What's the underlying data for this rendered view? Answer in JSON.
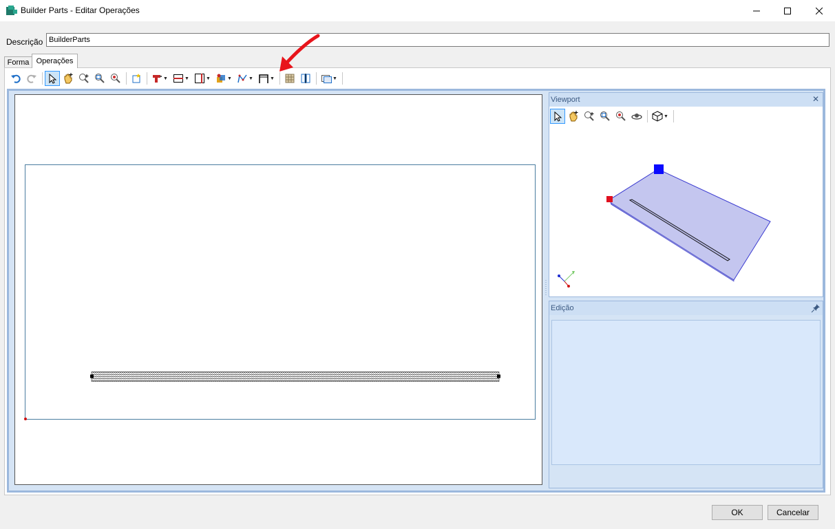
{
  "window": {
    "title": "Builder Parts - Editar Operações"
  },
  "description": {
    "label": "Descrição",
    "value": "BuilderParts"
  },
  "tabs": [
    {
      "label": "Forma"
    },
    {
      "label": "Operações"
    }
  ],
  "toolbar": {
    "icons": [
      "undo-icon",
      "redo-icon",
      "select-pointer-icon",
      "pan-hand-icon",
      "zoom-extents-icon",
      "zoom-window-icon",
      "zoom-out-icon",
      "new-part-icon",
      "drill-icon",
      "horizontal-cut-icon",
      "vertical-cut-icon",
      "pocket-icon",
      "polyline-icon",
      "frame-icon",
      "grid-icon",
      "split-vertical-icon",
      "view-options-icon"
    ]
  },
  "viewport": {
    "title": "Viewport"
  },
  "edicao": {
    "title": "Edição"
  },
  "buttons": {
    "ok": "OK",
    "cancel": "Cancelar"
  },
  "colors": {
    "accent": "#3399ff",
    "panel_border": "#9cb8dd",
    "panel_fill": "#d5e4f5",
    "model_fill": "#c4c6ef",
    "annotation_red": "#e8141b"
  }
}
